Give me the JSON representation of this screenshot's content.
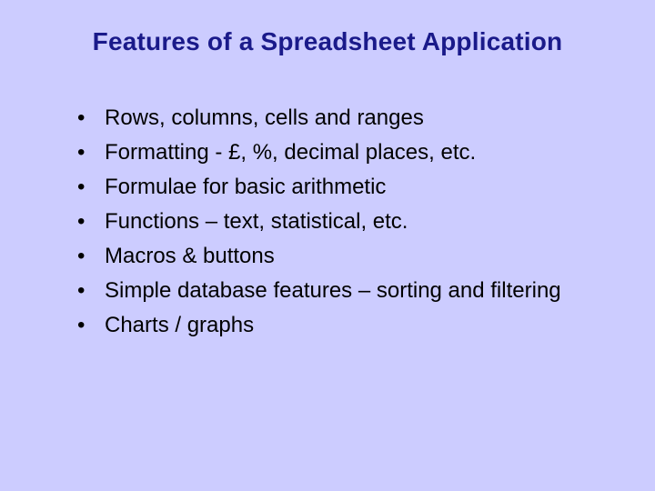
{
  "slide": {
    "title": "Features of a Spreadsheet Application",
    "bullets": [
      "Rows, columns, cells and ranges",
      "Formatting - £, %, decimal places, etc.",
      "Formulae for basic arithmetic",
      "Functions – text, statistical, etc.",
      "Macros & buttons",
      "Simple database features – sorting and filtering",
      "Charts / graphs"
    ]
  }
}
